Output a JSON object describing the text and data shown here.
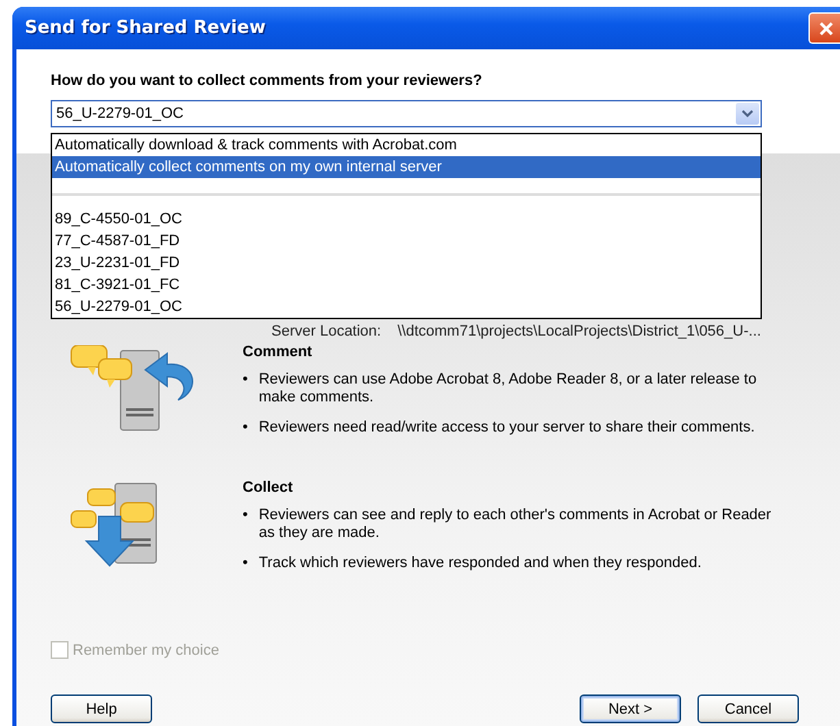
{
  "window": {
    "title": "Send for Shared Review"
  },
  "question": "How do you want to collect comments from your reviewers?",
  "combo": {
    "value": "56_U-2279-01_OC",
    "expanded": true
  },
  "dropdown_options": [
    {
      "kind": "option",
      "label": "Automatically download & track comments with Acrobat.com",
      "selected": false
    },
    {
      "kind": "option",
      "label": "Automatically collect comments on my own internal server",
      "selected": true
    },
    {
      "kind": "separator"
    },
    {
      "kind": "option",
      "label": "89_C-4550-01_OC",
      "selected": false
    },
    {
      "kind": "option",
      "label": "77_C-4587-01_FD",
      "selected": false
    },
    {
      "kind": "option",
      "label": "23_U-2231-01_FD",
      "selected": false
    },
    {
      "kind": "option",
      "label": "81_C-3921-01_FC",
      "selected": false
    },
    {
      "kind": "option",
      "label": "56_U-2279-01_OC",
      "selected": false
    }
  ],
  "server_location": {
    "label": "Server Location:",
    "value": "\\\\dtcomm71\\projects\\LocalProjects\\District_1\\056_U-..."
  },
  "sections": [
    {
      "kind": "comment",
      "title": "Comment",
      "bullets": [
        {
          "marker": "•",
          "text": "Reviewers can use Adobe Acrobat 8, Adobe Reader 8, or a later release to make comments."
        },
        {
          "marker": "•",
          "text": "Reviewers need read/write access to your server to share their comments."
        }
      ]
    },
    {
      "kind": "collect",
      "title": "Collect",
      "bullets": [
        {
          "marker": "•",
          "text": "Reviewers can see and reply to each other's comments in Acrobat or Reader as they are made."
        },
        {
          "marker": "•",
          "text": "Track which reviewers have responded and when they responded."
        }
      ]
    }
  ],
  "remember_choice": {
    "label": "Remember my choice",
    "checked": false,
    "disabled": true
  },
  "buttons": [
    {
      "label": "Help",
      "default": false
    },
    {
      "label": "Next >",
      "default": true
    },
    {
      "label": "Cancel",
      "default": false
    }
  ]
}
